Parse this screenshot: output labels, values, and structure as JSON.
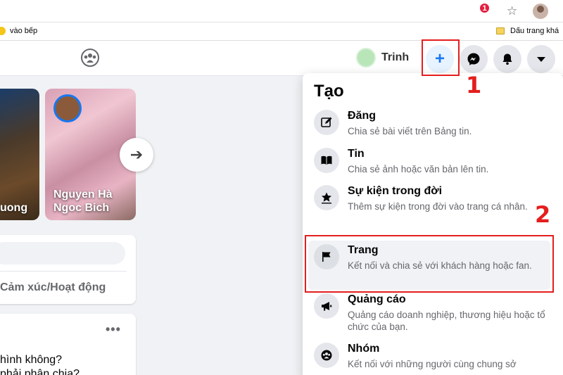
{
  "browser": {
    "bookmark_left": "vào bếp",
    "bookmark_right": "Dấu trang khá"
  },
  "header": {
    "user_name": "Trinh",
    "messenger_badge": "1"
  },
  "annotations": {
    "step1": "1",
    "step2": "2"
  },
  "feed": {
    "stories": [
      {
        "name": "uong"
      },
      {
        "name": "Nguyen Hà Ngoc Bich"
      }
    ],
    "composer": {
      "feeling_label": "Cảm xúc/Hoạt động"
    },
    "post": {
      "line1": "hình không?",
      "line2": "phải phân chia?"
    }
  },
  "create_menu": {
    "title": "Tạo",
    "items": [
      {
        "label": "Đăng",
        "desc": "Chia sẻ bài viết trên Bảng tin.",
        "icon": "edit-icon"
      },
      {
        "label": "Tin",
        "desc": "Chia sẻ ảnh hoặc văn bản lên tin.",
        "icon": "book-icon"
      },
      {
        "label": "Sự kiện trong đời",
        "desc": "Thêm sự kiện trong đời vào trang cá nhân.",
        "icon": "star-icon"
      },
      {
        "label": "Trang",
        "desc": "Kết nối và chia sẻ với khách hàng hoặc fan.",
        "icon": "flag-icon"
      },
      {
        "label": "Quảng cáo",
        "desc": "Quảng cáo doanh nghiệp, thương hiệu hoặc tổ chức của bạn.",
        "icon": "megaphone-icon"
      },
      {
        "label": "Nhóm",
        "desc": "Kết nối với những người cùng chung sở",
        "icon": "group-icon"
      }
    ]
  },
  "colors": {
    "accent": "#1877f2",
    "annotation_red": "#e41e1e",
    "badge_red": "#e41e3f"
  }
}
